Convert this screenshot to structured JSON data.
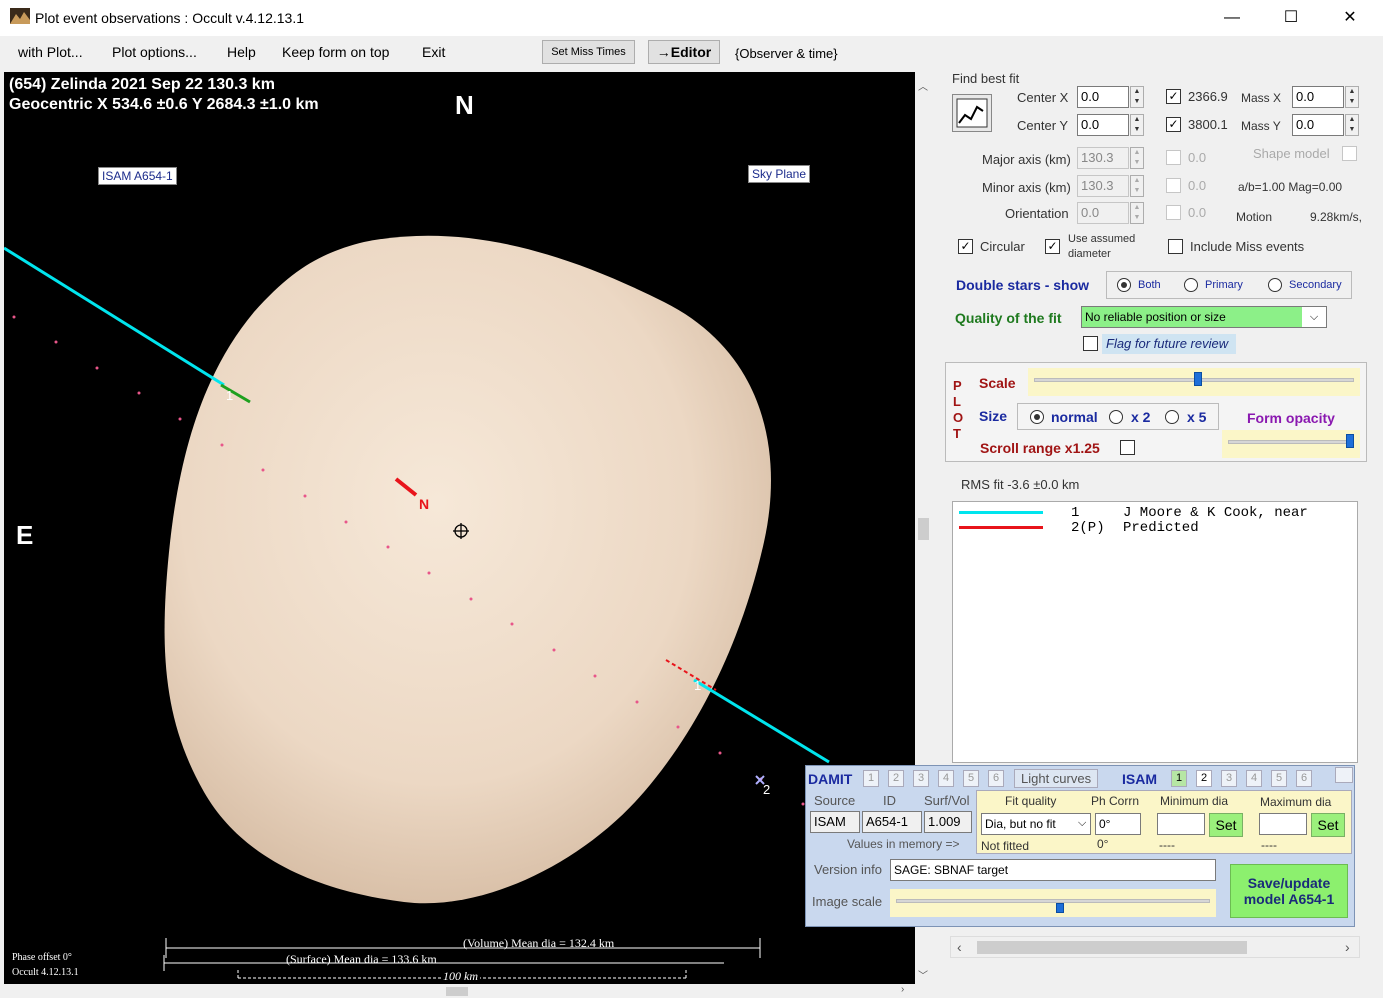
{
  "window": {
    "title": "Plot event observations : Occult v.4.12.13.1",
    "minimize": "—",
    "maximize": "☐",
    "close": "✕"
  },
  "menu": {
    "with_plot": "with Plot...",
    "plot_options": "Plot options...",
    "help": "Help",
    "keep_on_top": "Keep form on top",
    "exit": "Exit",
    "set_miss_times": "Set Miss Times",
    "editor": "→Editor",
    "observer_time": "{Observer & time}"
  },
  "plot": {
    "header_line1": "(654) Zelinda  2021 Sep 22   130.3 km",
    "header_line2": "Geocentric  X  534.6 ±0.6  Y 2684.3 ±1.0 km",
    "north": "N",
    "east": "E",
    "isam_tag": "ISAM A654-1",
    "sky_plane": "Sky Plane",
    "pole_label": "N",
    "chord1_label_a": "1",
    "chord1_label_b": "1",
    "chord2_label": "2",
    "volume_dia": "(Volume) Mean dia = 132.4 km",
    "surface_dia": "(Surface) Mean dia = 133.6 km",
    "scale_bar": "100 km",
    "phase_offset": "Phase offset 0°",
    "version": "Occult 4.12.13.1"
  },
  "fit": {
    "heading": "Find best fit",
    "center_x_label": "Center X",
    "center_x": "0.0",
    "center_y_label": "Center Y",
    "center_y": "0.0",
    "check_x_val": "2366.9",
    "check_y_val": "3800.1",
    "mass_x_label": "Mass X",
    "mass_x": "0.0",
    "mass_y_label": "Mass Y",
    "mass_y": "0.0",
    "major_label": "Major axis (km)",
    "major": "130.3",
    "minor_label": "Minor axis (km)",
    "minor": "130.3",
    "orient_label": "Orientation",
    "orient": "0.0",
    "dis_val1": "0.0",
    "dis_val2": "0.0",
    "dis_val3": "0.0",
    "shape_model": "Shape model",
    "ab_mag": "a/b=1.00  Mag=0.00",
    "motion_label": "Motion",
    "motion_val": "9.28km/s,",
    "circular": "Circular",
    "use_assumed": "Use assumed diameter",
    "include_miss": "Include Miss events",
    "double_stars": "Double stars - show",
    "ds_both": "Both",
    "ds_primary": "Primary",
    "ds_secondary": "Secondary",
    "quality_label": "Quality of the fit",
    "quality_value": "No reliable position or size",
    "flag_review": "Flag for future review"
  },
  "plotctl": {
    "vert_p": "P",
    "vert_l": "L",
    "vert_o": "O",
    "vert_t": "T",
    "scale": "Scale",
    "size": "Size",
    "size_normal": "normal",
    "size_x2": "x 2",
    "size_x5": "x 5",
    "form_opacity": "Form opacity",
    "scroll_range": "Scroll range x1.25"
  },
  "rms": "RMS fit -3.6 ±0.0 km",
  "legend": [
    {
      "num": "1",
      "name": "J Moore & K Cook, near",
      "color": "#00e5ee"
    },
    {
      "num": "2(P)",
      "name": "Predicted",
      "color": "#e8141b"
    }
  ],
  "damit": {
    "damit_label": "DAMIT",
    "n1": "1",
    "n2": "2",
    "n3": "3",
    "n4": "4",
    "n5": "5",
    "n6": "6",
    "light_curves": "Light curves",
    "isam_label": "ISAM",
    "i1": "1",
    "i2": "2",
    "i3": "3",
    "i4": "4",
    "i5": "5",
    "i6": "6",
    "source_h": "Source",
    "id_h": "ID",
    "surfvol_h": "Surf/Vol",
    "source": "ISAM",
    "id": "A654-1",
    "surfvol": "1.009",
    "fit_quality_h": "Fit quality",
    "ph_corrn_h": "Ph Corrn",
    "min_dia_h": "Minimum dia",
    "max_dia_h": "Maximum dia",
    "fit_quality": "Dia, but no fit",
    "ph_corrn": "0°",
    "set": "Set",
    "values_mem": "Values in memory =>",
    "not_fitted": "Not fitted",
    "ph_mem": "0°",
    "min_mem": "----",
    "max_mem": "----",
    "version_info_label": "Version info",
    "version_info": "SAGE: SBNAF target",
    "image_scale": "Image scale",
    "save_btn": "Save/update model A654-1"
  }
}
